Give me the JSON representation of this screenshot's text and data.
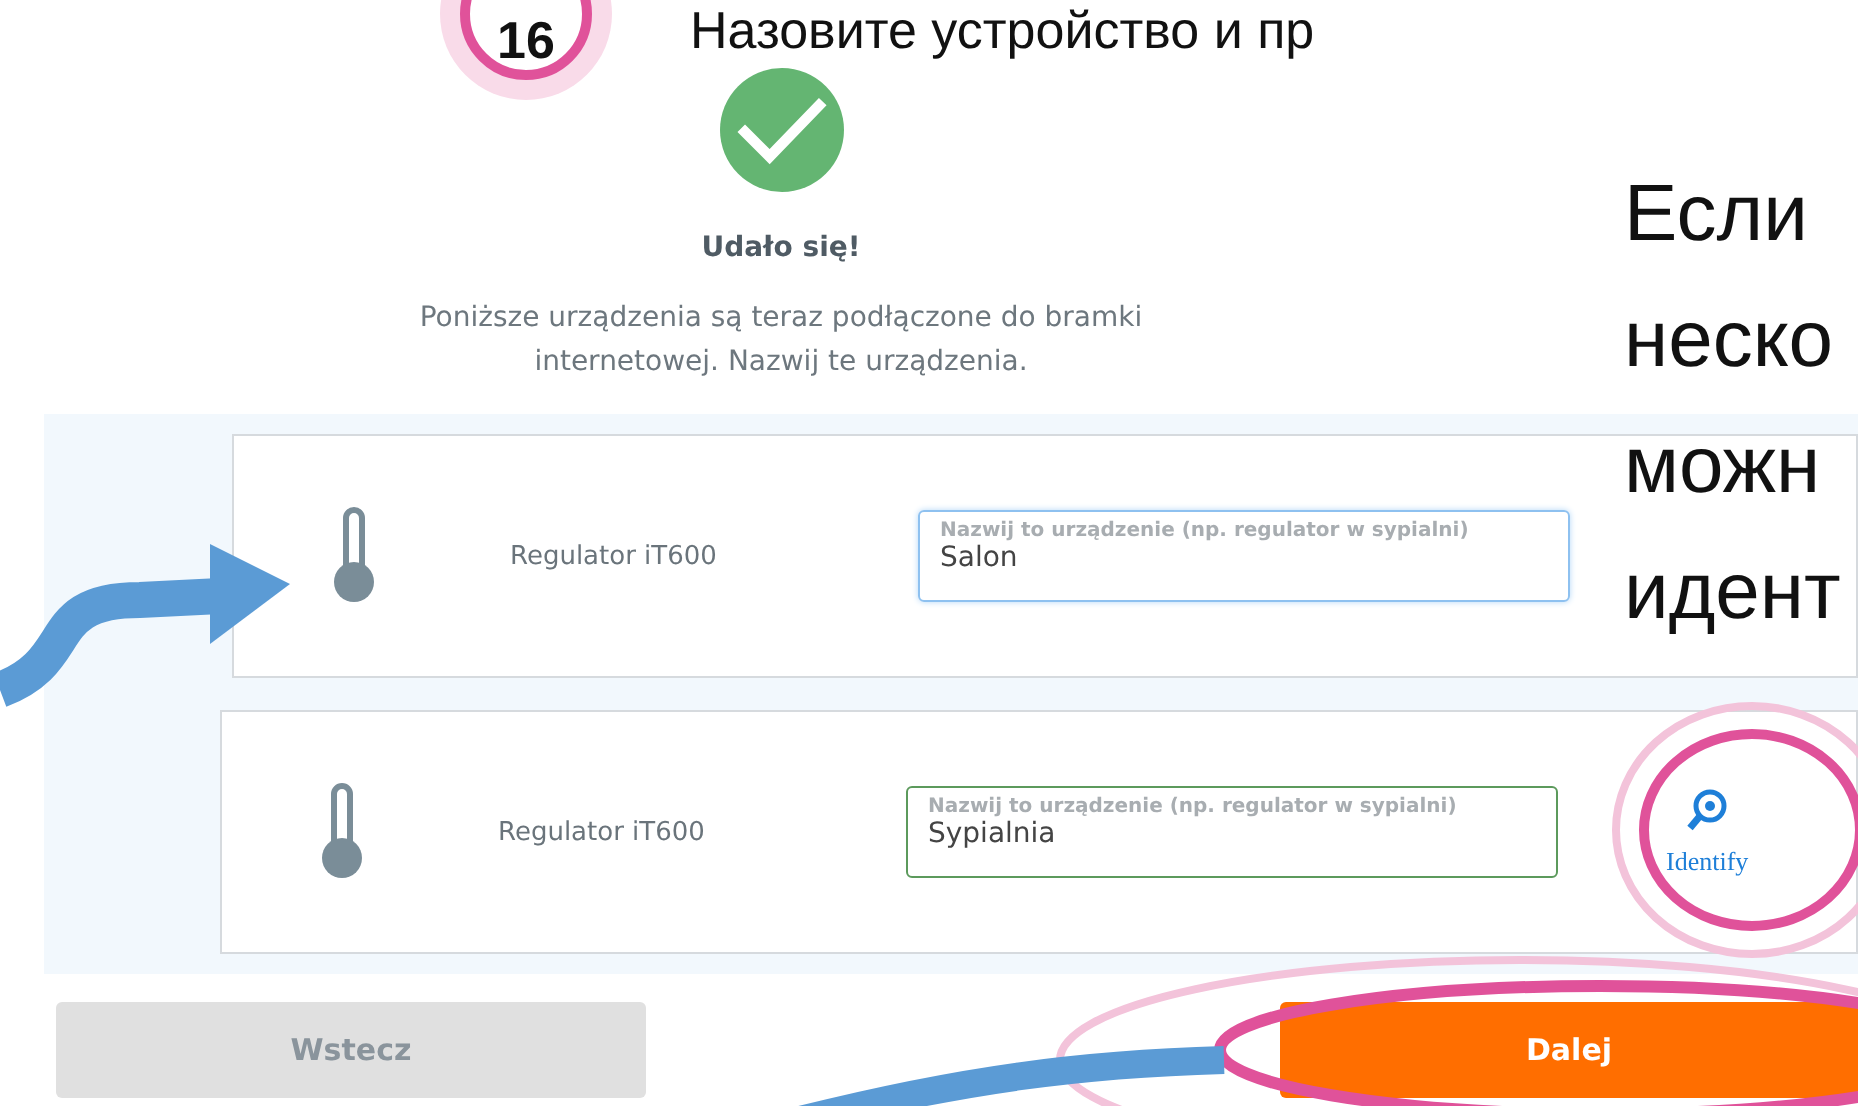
{
  "slide": {
    "step": "16",
    "title": "Назовите устройство и пр",
    "notes": [
      "Если",
      "неско",
      "можн",
      "идент"
    ]
  },
  "screen": {
    "title": "Udało się!",
    "message": "Poniższe urządzenia są teraz podłączone do bramki internetowej. Nazwij te urządzenia.",
    "devices": [
      {
        "name": "Regulator iT600",
        "placeholder": "Nazwij to urządzenie (np. regulator w sypialni)",
        "value": "Salon",
        "focused": true
      },
      {
        "name": "Regulator iT600",
        "placeholder": "Nazwij to urządzenie (np. regulator w sypialni)",
        "value": "Sypialnia",
        "focused": false,
        "identify": "Identify"
      }
    ],
    "buttons": [
      {
        "label": "Wstecz",
        "kind": "secondary"
      },
      {
        "label": "Dalej",
        "kind": "primary"
      }
    ]
  }
}
